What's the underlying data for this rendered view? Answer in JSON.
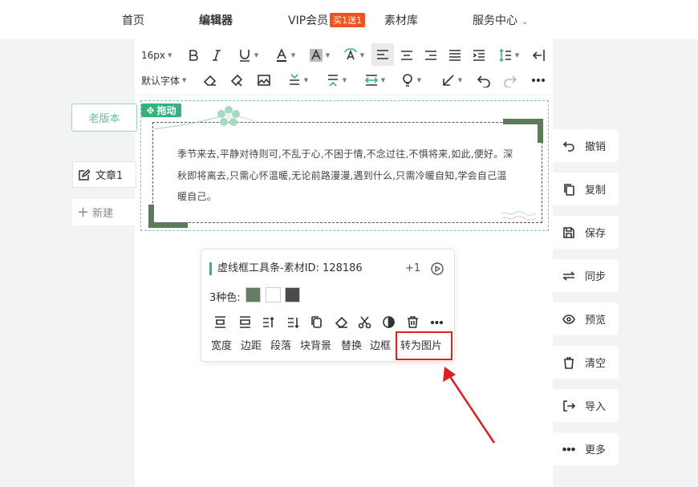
{
  "nav": {
    "home": "首页",
    "editor": "编辑器",
    "vip": "VIP会员",
    "vip_badge": "买1送1",
    "materials": "素材库",
    "service": "服务中心"
  },
  "toolbar": {
    "font_size": "16px",
    "font_family": "默认字体",
    "icons": [
      "bold-icon",
      "italic-icon",
      "underline-icon",
      "font-color-icon",
      "highlight-icon",
      "text-effect-icon",
      "align-left-icon",
      "align-center-icon",
      "align-right-icon",
      "justify-icon",
      "indent-icon",
      "line-height-icon",
      "exit-icon",
      "eraser-icon",
      "format-painter-icon",
      "image-icon",
      "paragraph-spacing-before-icon",
      "paragraph-spacing-after-icon",
      "letter-spacing-icon",
      "bulb-icon",
      "arrow-icon",
      "undo-icon",
      "redo-icon",
      "more-icon"
    ]
  },
  "left_panel": {
    "old_version": "老版本",
    "article": "文章1",
    "new": "新建"
  },
  "material": {
    "drag_label": "拖动",
    "text": "季节来去,平静对待则可,不乱于心,不困于情,不念过往,不惧将来,如此,便好。深秋即将离去,只需心怀温暖,无论前路漫漫,遇到什么,只需冷暖自知,学会自己温暖自己。"
  },
  "right_tools": [
    {
      "label": "撤销",
      "icon": "undo-icon"
    },
    {
      "label": "复制",
      "icon": "copy-icon"
    },
    {
      "label": "保存",
      "icon": "save-icon"
    },
    {
      "label": "同步",
      "icon": "sync-icon"
    },
    {
      "label": "预览",
      "icon": "eye-icon"
    },
    {
      "label": "清空",
      "icon": "trash-icon"
    },
    {
      "label": "导入",
      "icon": "import-icon"
    },
    {
      "label": "更多",
      "icon": "more-icon"
    }
  ],
  "popup": {
    "title": "虚线框工具条-素材ID: 128186",
    "plus_one": "+1",
    "colors_label": "3种色:",
    "colors": [
      "#637f63",
      "#ffffff",
      "#4a4a4a"
    ],
    "labels": [
      "宽度",
      "边距",
      "段落",
      "块背景",
      "替换",
      "边框",
      "转为图片"
    ]
  },
  "colors": {
    "accent": "#35b37e",
    "highlight_box": "#e02020",
    "decor": "#5d7a5b"
  }
}
